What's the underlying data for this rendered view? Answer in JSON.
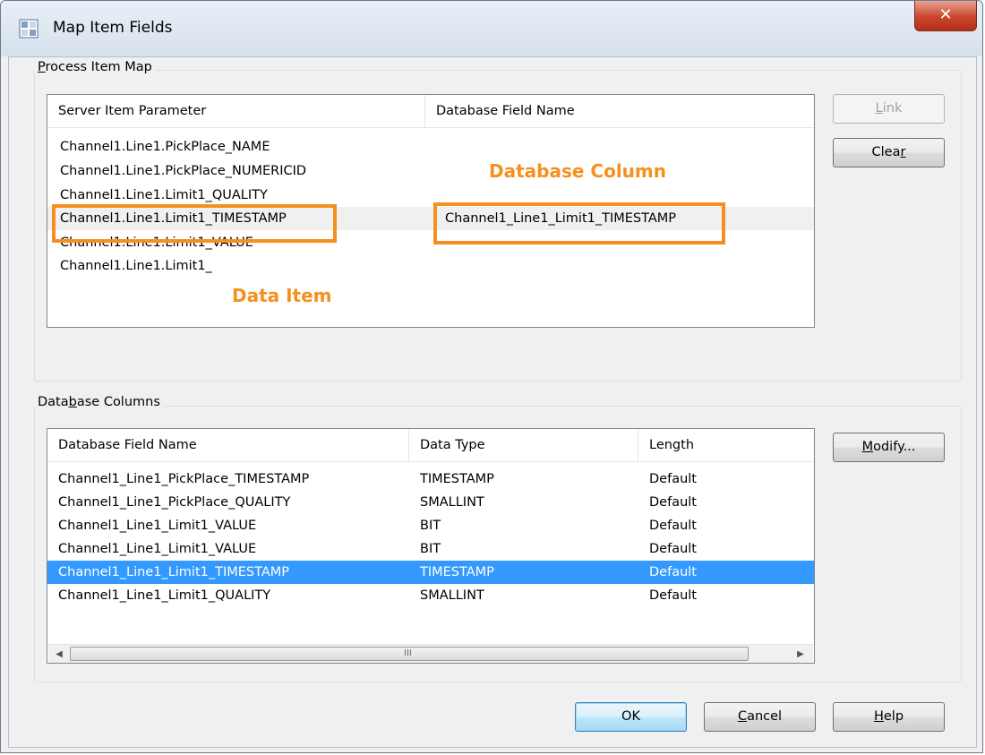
{
  "window": {
    "title": "Map Item Fields",
    "close_symbol": "✕",
    "app_icon": "map-grid-icon"
  },
  "process_map": {
    "legend_mnemonic": "P",
    "legend_rest": "rocess Item Map",
    "columns": [
      "Server Item Parameter",
      "Database Field Name"
    ],
    "rows": [
      {
        "param": "Channel1.Line1.PickPlace_NAME",
        "field": ""
      },
      {
        "param": "Channel1.Line1.PickPlace_NUMERICID",
        "field": ""
      },
      {
        "param": "Channel1.Line1.Limit1_QUALITY",
        "field": ""
      },
      {
        "param": "Channel1.Line1.Limit1_TIMESTAMP",
        "field": "Channel1_Line1_Limit1_TIMESTAMP"
      },
      {
        "param": "Channel1.Line1.Limit1_VALUE",
        "field": ""
      },
      {
        "param": "Channel1.Line1.Limit1_",
        "field": ""
      }
    ],
    "link_button": {
      "mnemonic": "L",
      "rest": "ink"
    },
    "clear_button": {
      "before": "Clea",
      "mnemonic": "r"
    }
  },
  "annotations": {
    "database_column": "Database Column",
    "data_item": "Data Item",
    "color": "#f5901e"
  },
  "db_columns": {
    "legend_before": "Data",
    "legend_mnemonic": "b",
    "legend_after": "ase Columns",
    "columns": [
      "Database Field Name",
      "Data Type",
      "Length"
    ],
    "rows": [
      {
        "name": "Channel1_Line1_PickPlace_TIMESTAMP",
        "type": "TIMESTAMP",
        "length": "Default"
      },
      {
        "name": "Channel1_Line1_PickPlace_QUALITY",
        "type": "SMALLINT",
        "length": "Default"
      },
      {
        "name": "Channel1_Line1_Limit1_VALUE",
        "type": "BIT",
        "length": "Default"
      },
      {
        "name": "Channel1_Line1_Limit1_VALUE",
        "type": "BIT",
        "length": "Default"
      },
      {
        "name": "Channel1_Line1_Limit1_TIMESTAMP",
        "type": "TIMESTAMP",
        "length": "Default"
      },
      {
        "name": "Channel1_Line1_Limit1_QUALITY",
        "type": "SMALLINT",
        "length": "Default"
      }
    ],
    "selected_row": 4,
    "selection_color": "#3399ff",
    "modify_button": {
      "mnemonic": "M",
      "rest": "odify..."
    },
    "scroll": {
      "left": "◀",
      "right": "▶",
      "grip": "III"
    }
  },
  "footer": {
    "ok": "OK",
    "cancel": {
      "mnemonic": "C",
      "rest": "ancel"
    },
    "help": {
      "mnemonic": "H",
      "rest": "elp"
    }
  }
}
